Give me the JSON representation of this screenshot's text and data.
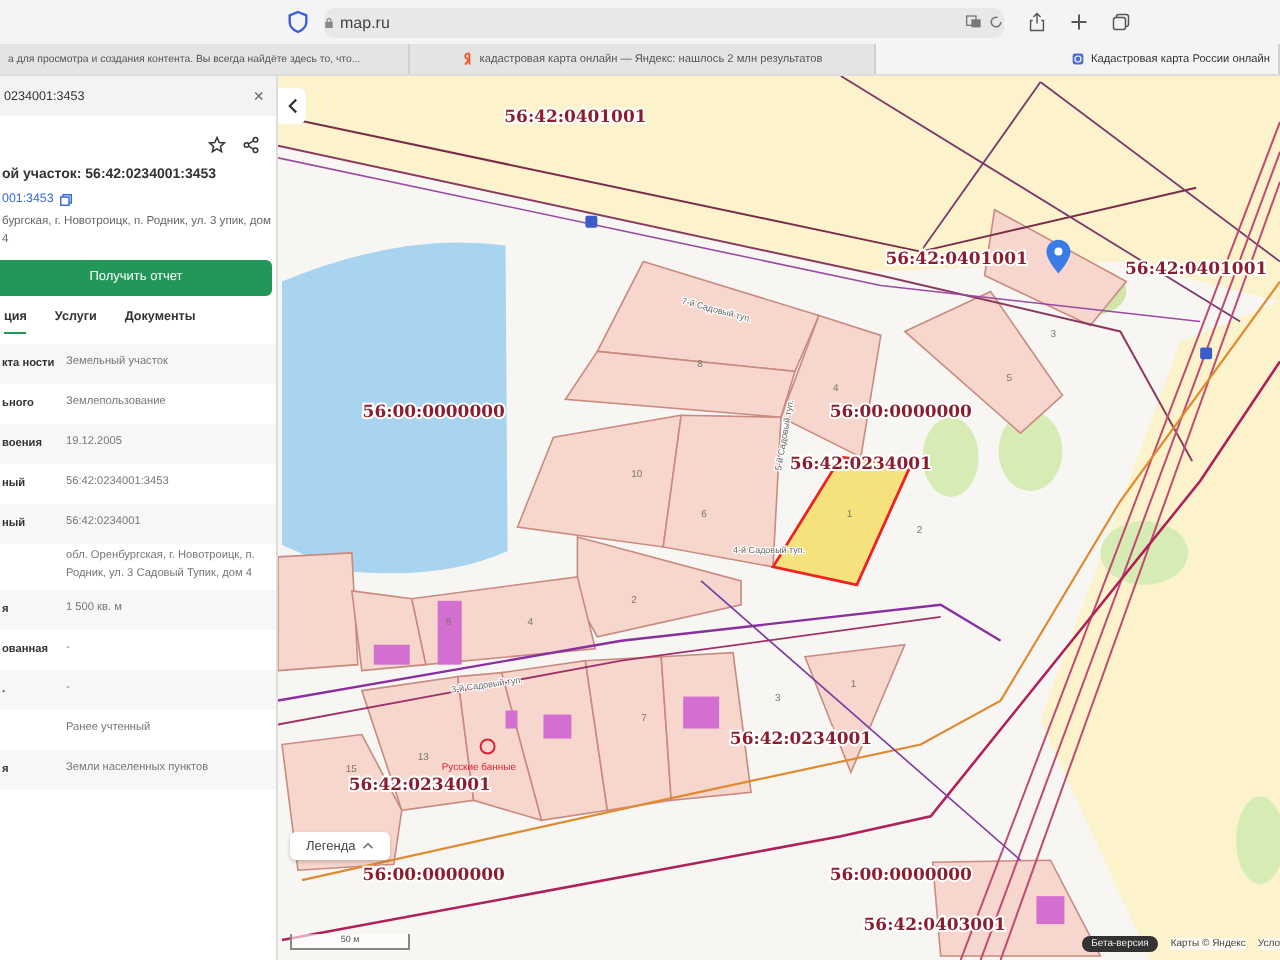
{
  "browser": {
    "url": "map.ru",
    "tabs": [
      {
        "title": "а для просмотра и создания контента. Вы всегда найдёте здесь то, что...",
        "selected": false,
        "kind": "plain"
      },
      {
        "title": "кадастровая карта онлайн — Яндекс: нашлось 2 млн результатов",
        "selected": false,
        "kind": "yandex"
      },
      {
        "title": "Кадастровая карта России онлайн",
        "selected": true,
        "kind": "site"
      }
    ]
  },
  "panel": {
    "search_value": "0234001:3453",
    "close": "×",
    "title": "ой участок: 56:42:0234001:3453",
    "number_link": "001:3453",
    "address": "бургская, г. Новотроицк, п. Родник, ул. 3 упик, дом 4",
    "report_button": "Получить отчет",
    "tabs": [
      {
        "label": "ция",
        "selected": true
      },
      {
        "label": "Услуги",
        "selected": false
      },
      {
        "label": "Документы",
        "selected": false
      }
    ],
    "rows": [
      {
        "label": "кта ности",
        "value": "Земельный участок"
      },
      {
        "label": "ьного",
        "value": "Землепользование"
      },
      {
        "label": "воения",
        "value": "19.12.2005"
      },
      {
        "label": "ный",
        "value": "56:42:0234001:3453"
      },
      {
        "label": "ный",
        "value": "56:42:0234001"
      },
      {
        "label": "",
        "value": "обл. Оренбургская, г. Новотроицк, п. Родник, ул. 3 Садовый Тупик, дом 4"
      },
      {
        "label": "я",
        "value": "1 500 кв. м"
      },
      {
        "label": "ованная",
        "value": "-"
      },
      {
        "label": ".",
        "value": "-"
      },
      {
        "label": "",
        "value": "Ранее учтенный"
      },
      {
        "label": "я",
        "value": "Земли населенных пунктов"
      }
    ]
  },
  "map": {
    "zone_labels": [
      "56:42:0401001",
      "56:42:0401001",
      "56:42:0401001",
      "56:00:0000000",
      "56:00:0000000",
      "56:42:0234001",
      "56:42:0234001",
      "56:42:0234001",
      "56:00:0000000",
      "56:00:0000000",
      "56:42:0403001"
    ],
    "street_labels": [
      "7-й Садовый туп.",
      "5-й Садовый туп.",
      "4-й Садовый туп.",
      "3-й Садовый туп."
    ],
    "parcel_numbers": [
      "8",
      "4",
      "10",
      "6",
      "1",
      "2",
      "5",
      "3",
      "1",
      "2",
      "4",
      "3",
      "7",
      "15",
      "13",
      "6"
    ],
    "poi_label": "Русские банные",
    "legend_button": "Легенда",
    "scale": "50 м",
    "beta_badge": "Бета-версия",
    "copyright": "Карты © Яндекс",
    "terms": "Усло"
  }
}
